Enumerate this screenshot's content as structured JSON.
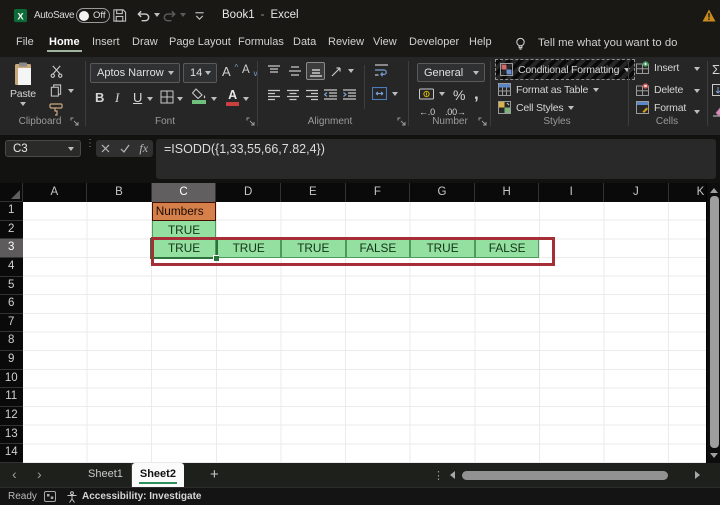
{
  "title_bar": {
    "autosave_label": "AutoSave",
    "autosave_state": "Off",
    "workbook": "Book1",
    "separator": "-",
    "app": "Excel"
  },
  "menu": {
    "items": [
      "File",
      "Home",
      "Insert",
      "Draw",
      "Page Layout",
      "Formulas",
      "Data",
      "Review",
      "View",
      "Developer",
      "Help"
    ],
    "active_item": "Home",
    "tell_me": "Tell me what you want to do"
  },
  "ribbon": {
    "clipboard_label": "Clipboard",
    "paste_label": "Paste",
    "font_label": "Font",
    "font_name": "Aptos Narrow",
    "font_size": "14",
    "bold": "B",
    "italic": "I",
    "underline": "U",
    "alignment_label": "Alignment",
    "number_label": "Number",
    "number_format": "General",
    "percent": "%",
    "comma": ",",
    "inc_decimal": "←.0",
    "dec_decimal": ".00→",
    "styles_label": "Styles",
    "styles_items": [
      "Conditional Formatting",
      "Format as Table",
      "Cell Styles"
    ],
    "cells_label": "Cells",
    "cells_items": [
      "Insert",
      "Delete",
      "Format"
    ],
    "autosum": "Σ"
  },
  "formula_bar": {
    "name_box": "C3",
    "fx": "fx",
    "formula": "=ISODD({1,33,55,66,7.82,4})"
  },
  "grid": {
    "columns": [
      "A",
      "B",
      "C",
      "D",
      "E",
      "F",
      "G",
      "H",
      "I",
      "J",
      "K"
    ],
    "row_count": 14,
    "selected_column": "C",
    "selected_row": 3,
    "cells": [
      {
        "ref": "C1",
        "text": "Numbers",
        "bg": "#D57F4B",
        "text_color": "#1d0d02",
        "align": "left",
        "border_color": "#411000"
      },
      {
        "ref": "C2",
        "text": "TRUE",
        "bg": "#93E0A1",
        "text_color": "#123415",
        "align": "center"
      },
      {
        "ref": "C3",
        "text": "TRUE",
        "bg": "#93E0A1",
        "text_color": "#123415",
        "align": "center"
      },
      {
        "ref": "D3",
        "text": "TRUE",
        "bg": "#93E0A1",
        "text_color": "#123415",
        "align": "center"
      },
      {
        "ref": "E3",
        "text": "TRUE",
        "bg": "#93E0A1",
        "text_color": "#123415",
        "align": "center"
      },
      {
        "ref": "F3",
        "text": "FALSE",
        "bg": "#93E0A1",
        "text_color": "#123415",
        "align": "center"
      },
      {
        "ref": "G3",
        "text": "TRUE",
        "bg": "#93E0A1",
        "text_color": "#123415",
        "align": "center"
      },
      {
        "ref": "H3",
        "text": "FALSE",
        "bg": "#93E0A1",
        "text_color": "#123415",
        "align": "center"
      }
    ],
    "selection": {
      "ref": "C3",
      "color": "#2D723B"
    },
    "annotation": {
      "range": "C3:H3",
      "color": "#A62E37"
    }
  },
  "sheet_bar": {
    "tabs": [
      {
        "name": "Sheet1",
        "active": false
      },
      {
        "name": "Sheet2",
        "active": true
      }
    ],
    "add_label": "+"
  },
  "status_bar": {
    "mode": "Ready",
    "accessibility": "Accessibility: Investigate"
  }
}
